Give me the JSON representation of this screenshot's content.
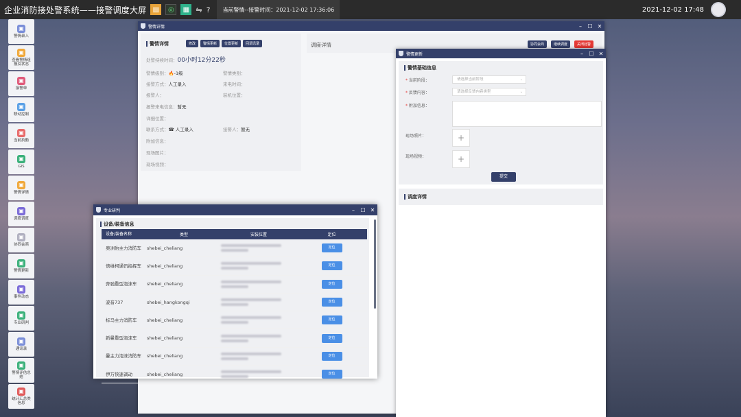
{
  "app": {
    "title": "企业消防接处警系统——接警调度大屏",
    "alarm_text": "当前警情--接警时间：2021-12-02 17:36:06",
    "datetime": "2021-12-02 17:48",
    "icons": [
      "bell-icon",
      "record-icon",
      "screen-icon",
      "switch-icon",
      "help-icon"
    ]
  },
  "sidebar": {
    "items": [
      {
        "label": "警情录入",
        "icon": "entry-icon",
        "color": "#7a8ed8"
      },
      {
        "label": "查看警情组\n报及状态",
        "icon": "status-icon",
        "color": "#f0a83a"
      },
      {
        "label": "接警单",
        "icon": "form-icon",
        "color": "#e05a7a"
      },
      {
        "label": "联动控制",
        "icon": "linkage-icon",
        "color": "#5aa0e6"
      },
      {
        "label": "当前执勤",
        "icon": "duty-icon",
        "color": "#e86a6a"
      },
      {
        "label": "GIS",
        "icon": "gis-icon",
        "color": "#3ab07a"
      },
      {
        "label": "警情详情",
        "icon": "detail-icon",
        "color": "#f0a83a"
      },
      {
        "label": "调度调度",
        "icon": "dispatch-icon",
        "color": "#7a6ad8"
      },
      {
        "label": "协同会商",
        "icon": "meeting-icon",
        "color": "#b0b0c0"
      },
      {
        "label": "警情更新",
        "icon": "update-icon",
        "color": "#3ab07a"
      },
      {
        "label": "事件动态",
        "icon": "event-icon",
        "color": "#7a6ad8"
      },
      {
        "label": "专业研判",
        "icon": "research-icon",
        "color": "#3ab07a"
      },
      {
        "label": "通讯录",
        "icon": "contacts-icon",
        "color": "#7a8ed8"
      },
      {
        "label": "警情评估总\n结",
        "icon": "evaluate-icon",
        "color": "#3ab07a"
      },
      {
        "label": "统计汇总类\n信息",
        "icon": "stats-icon",
        "color": "#e05a5a"
      }
    ]
  },
  "detail_window": {
    "title": "警情详情",
    "section": "警情详情",
    "buttons": [
      "修改",
      "警情更新",
      "位置更新",
      "回调讯录"
    ],
    "duration_label": "处警持续时间：",
    "duration_value": "00小时12分22秒",
    "fields": {
      "level_label": "警情级别：",
      "level_value": "-1级",
      "category_label": "警情类别：",
      "report_label": "接警方式：",
      "report_value": "人工录入",
      "call_time_label": "来电时间：",
      "reporter_label": "报警人：",
      "location_label": "装机位置：",
      "caller_num_label": "报警来电信息：",
      "caller_num_value": "暂无",
      "address_label": "详细位置：",
      "contact_label": "联系方式：",
      "contact_value": "人工录入",
      "receiver_label": "接警人：",
      "receiver_value": "暂无",
      "extra_label": "附加信息：",
      "photo_label": "现场图片：",
      "video_label": "现场视频："
    },
    "dispatch_title": "调度详情",
    "dispatch_buttons": [
      "协同会商",
      "继续调度",
      "关闭处警"
    ]
  },
  "update_window": {
    "title": "警情更新",
    "section": "警情基础信息",
    "stage_label": "当前阶段：",
    "stage_placeholder": "请选择当前阶段",
    "feedback_label": "反馈内容：",
    "feedback_placeholder": "请选择反馈内容类型",
    "extra_label": "附加信息：",
    "photo_label": "现场照片：",
    "video_label": "现场视频：",
    "submit": "提交",
    "dispatch_title": "调度详情"
  },
  "research_window": {
    "title": "专业研判",
    "section": "设备/装备信息",
    "columns": [
      "设备/装备名称",
      "类型",
      "安装位置",
      "定位"
    ],
    "rows": [
      {
        "name": "奥洲豹主力消防车",
        "type": "shebei_cheliang",
        "locate": "定位"
      },
      {
        "name": "倍维柯通讯指挥车",
        "type": "shebei_cheliang",
        "locate": "定位"
      },
      {
        "name": "奔驰重型泡沫车",
        "type": "shebei_cheliang",
        "locate": "定位"
      },
      {
        "name": "波音737",
        "type": "shebei_hangkongqi",
        "locate": "定位"
      },
      {
        "name": "标马主力消防车",
        "type": "shebei_cheliang",
        "locate": "定位"
      },
      {
        "name": "新曼重型泡沫车",
        "type": "shebei_cheliang",
        "locate": "定位"
      },
      {
        "name": "曼主力泡沫消防车",
        "type": "shebei_cheliang",
        "locate": "定位"
      },
      {
        "name": "伊万快速调动",
        "type": "shebei_cheliang",
        "locate": "定位"
      }
    ]
  }
}
